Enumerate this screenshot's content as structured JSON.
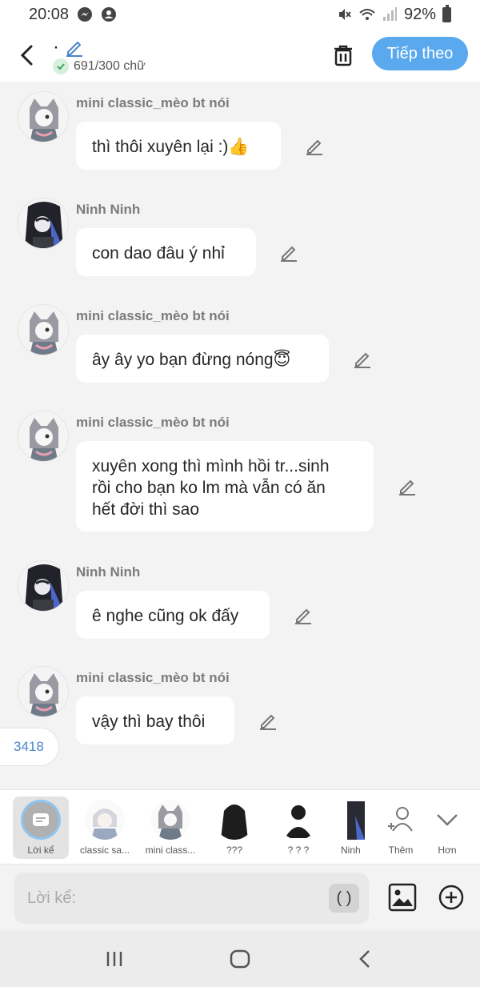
{
  "status_bar": {
    "time": "20:08",
    "battery": "92%"
  },
  "header": {
    "title": "·",
    "counter": "691/300 chữ",
    "next_label": "Tiếp theo"
  },
  "messages": [
    {
      "sender": "mini classic_mèo bt nói",
      "text": "thì thôi xuyên lại :)👍"
    },
    {
      "sender": "Ninh Ninh",
      "text": "con dao đâu ý nhỉ"
    },
    {
      "sender": "mini classic_mèo bt nói",
      "text": "ây ây yo bạn đừng nóng😇"
    },
    {
      "sender": "mini classic_mèo bt nói",
      "lines": [
        "xuyên xong thì mình hồi tr...sinh",
        "rồi cho bạn ko lm mà vẫn có ăn",
        "hết đời thì sao"
      ]
    },
    {
      "sender": "Ninh Ninh",
      "text": "ê nghe cũng ok đấy"
    },
    {
      "sender": "mini classic_mèo bt nói",
      "text": "vậy thì bay thôi"
    }
  ],
  "count_chip": "3418",
  "characters": [
    {
      "name": "Lời kể",
      "icon": "narration-icon",
      "selected": true
    },
    {
      "name": "classic sa...",
      "icon": "character-avatar"
    },
    {
      "name": "mini class...",
      "icon": "character-avatar"
    },
    {
      "name": "???",
      "icon": "character-silhouette"
    },
    {
      "name": "? ? ?",
      "icon": "character-silhouette"
    },
    {
      "name": "Ninh",
      "icon": "character-avatar"
    },
    {
      "name": "Thêm",
      "icon": "add-person-icon"
    },
    {
      "name": "Hơn",
      "icon": "chevron-down-icon"
    }
  ],
  "input": {
    "placeholder": "Lời kể:",
    "paren_label": "( )"
  },
  "colors": {
    "accent": "#5aa9ef",
    "link": "#4a86c8",
    "background": "#f3f3f3"
  }
}
